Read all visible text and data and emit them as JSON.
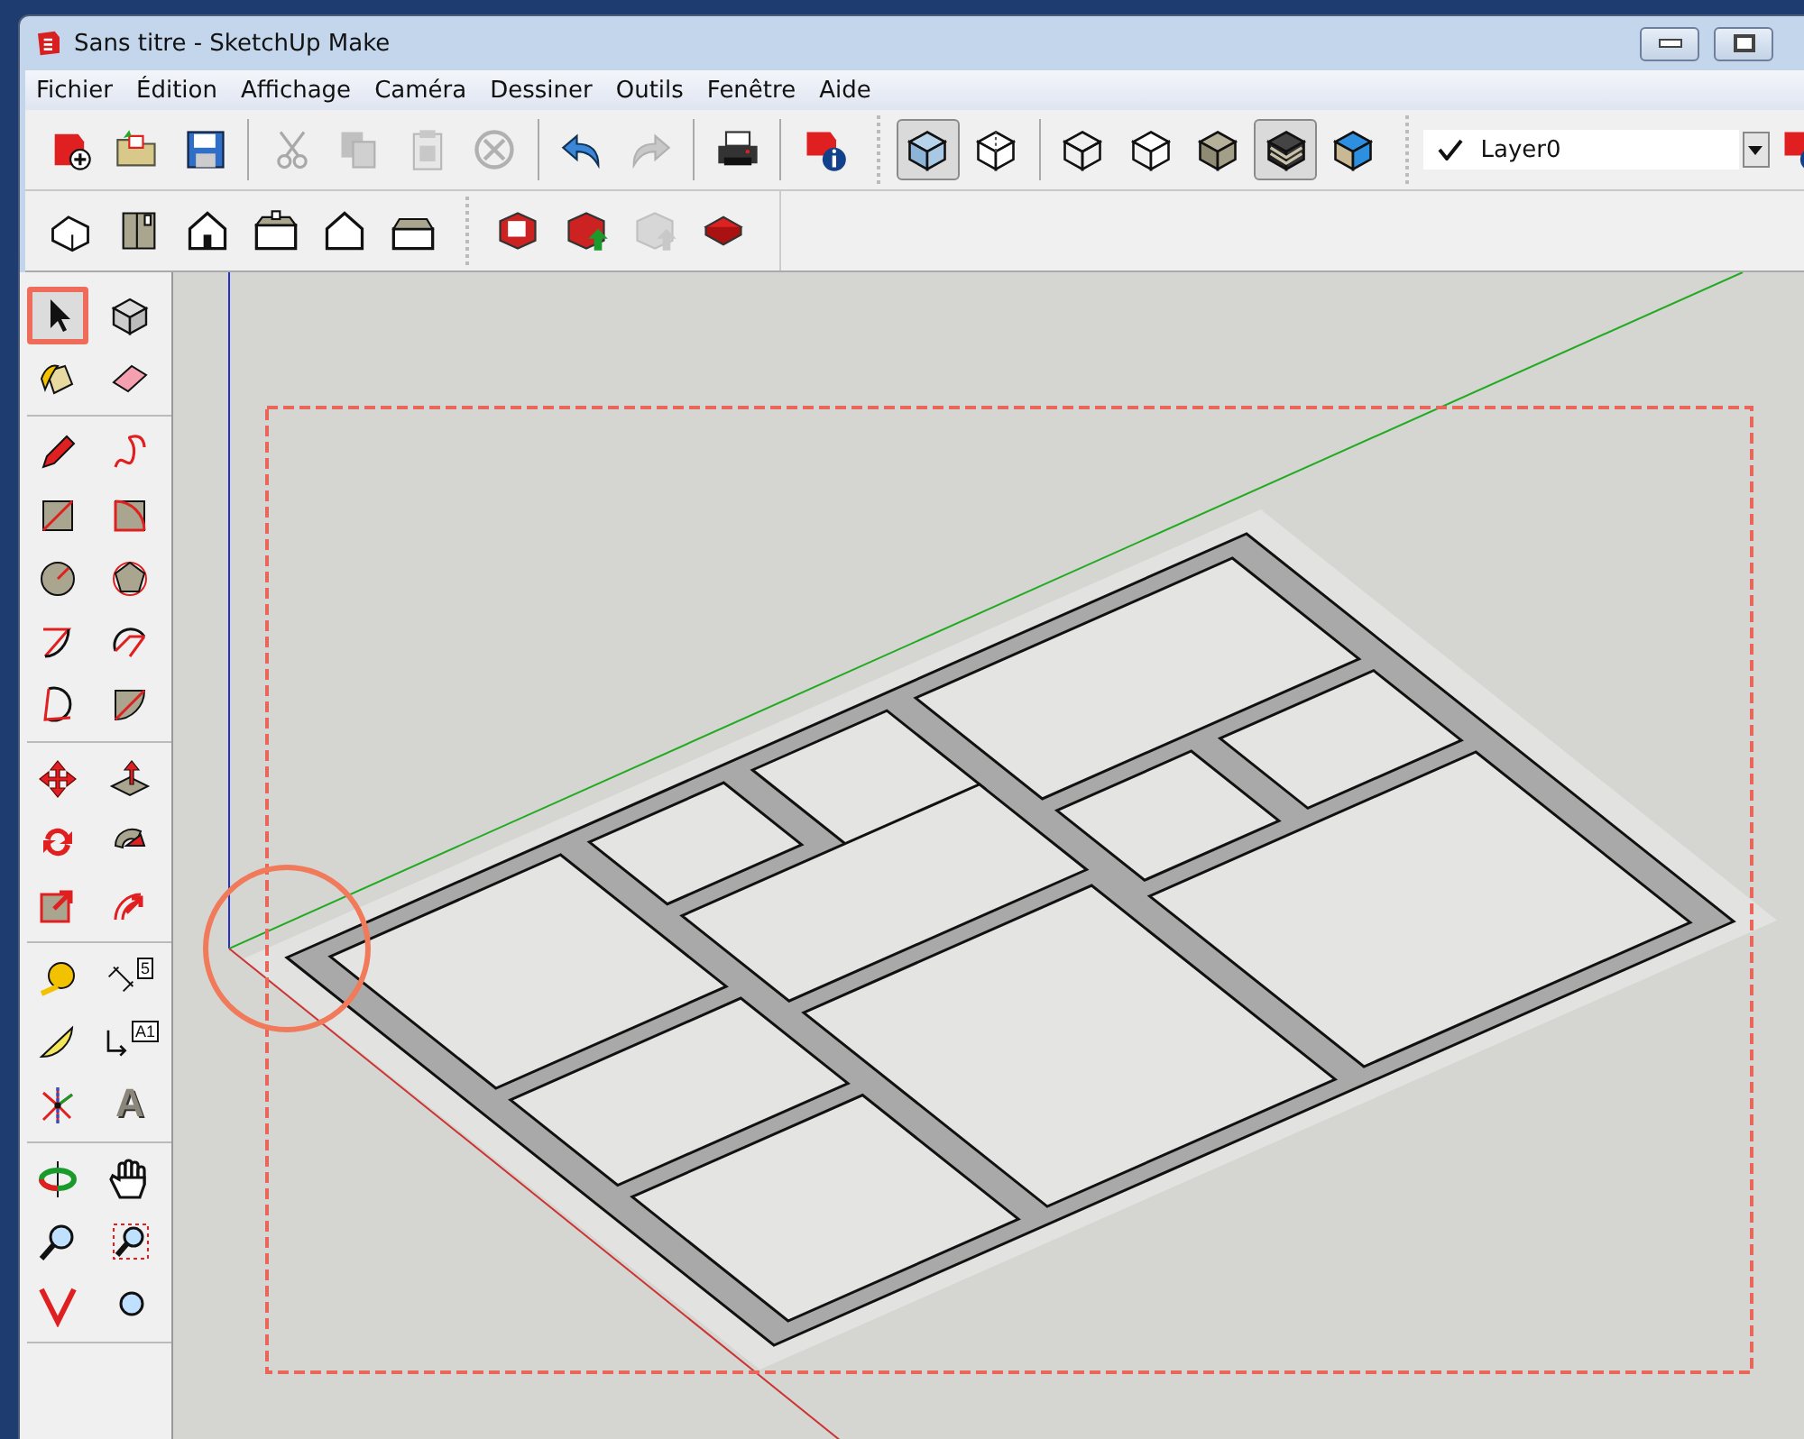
{
  "window": {
    "title": "Sans titre - SketchUp Make"
  },
  "menu": [
    "Fichier",
    "Édition",
    "Affichage",
    "Caméra",
    "Dessiner",
    "Outils",
    "Fenêtre",
    "Aide"
  ],
  "toolbar_1": [
    {
      "kind": "button",
      "disabled": false,
      "selected": false
    },
    {
      "kind": "button",
      "disabled": false,
      "selected": false
    },
    {
      "kind": "button",
      "disabled": false,
      "selected": false
    },
    {
      "kind": "separator"
    },
    {
      "kind": "button",
      "disabled": true,
      "selected": false
    },
    {
      "kind": "button",
      "disabled": true,
      "selected": false
    },
    {
      "kind": "button",
      "disabled": true,
      "selected": false
    },
    {
      "kind": "button",
      "disabled": true,
      "selected": false
    },
    {
      "kind": "separator"
    },
    {
      "kind": "button",
      "disabled": false,
      "selected": false
    },
    {
      "kind": "button",
      "disabled": true,
      "selected": false
    },
    {
      "kind": "separator"
    },
    {
      "kind": "button",
      "disabled": false,
      "selected": false
    },
    {
      "kind": "separator"
    },
    {
      "kind": "button",
      "disabled": false,
      "selected": false
    },
    {
      "kind": "grip"
    },
    {
      "kind": "button",
      "disabled": false,
      "selected": true
    },
    {
      "kind": "button",
      "disabled": false,
      "selected": false
    },
    {
      "kind": "separator"
    },
    {
      "kind": "button",
      "disabled": false,
      "selected": false
    },
    {
      "kind": "button",
      "disabled": false,
      "selected": false
    },
    {
      "kind": "button",
      "disabled": false,
      "selected": false
    },
    {
      "kind": "button",
      "disabled": false,
      "selected": true
    },
    {
      "kind": "button",
      "disabled": false,
      "selected": false
    }
  ],
  "layer": {
    "name": "Layer0",
    "current": true
  },
  "toolbar_2": [
    {
      "kind": "button",
      "disabled": false
    },
    {
      "kind": "button",
      "disabled": false
    },
    {
      "kind": "button",
      "disabled": false
    },
    {
      "kind": "button",
      "disabled": false
    },
    {
      "kind": "button",
      "disabled": false
    },
    {
      "kind": "button",
      "disabled": false
    },
    {
      "kind": "grip"
    },
    {
      "kind": "button",
      "disabled": false
    },
    {
      "kind": "button",
      "disabled": false
    },
    {
      "kind": "button",
      "disabled": true
    },
    {
      "kind": "button",
      "disabled": false
    }
  ],
  "toolbox": [
    [
      {
        "selected": true
      },
      {
        "selected": false
      },
      {
        "selected": false
      },
      {
        "selected": false
      }
    ],
    [
      {
        "selected": false
      },
      {
        "selected": false
      },
      {
        "selected": false
      },
      {
        "selected": false
      },
      {
        "selected": false
      },
      {
        "selected": false
      },
      {
        "selected": false
      },
      {
        "selected": false
      },
      {
        "selected": false
      },
      {
        "selected": false
      }
    ],
    [
      {
        "selected": false
      },
      {
        "selected": false
      },
      {
        "selected": false
      },
      {
        "selected": false
      },
      {
        "selected": false
      },
      {
        "selected": false
      }
    ],
    [
      {
        "selected": false
      },
      {
        "selected": false,
        "label": "5"
      },
      {
        "selected": false
      },
      {
        "selected": false,
        "label": "A1"
      },
      {
        "selected": false
      },
      {
        "selected": false,
        "label": "A"
      }
    ],
    [
      {
        "selected": false
      },
      {
        "selected": false
      },
      {
        "selected": false
      },
      {
        "selected": false
      },
      {
        "selected": false
      },
      {
        "selected": false
      }
    ]
  ]
}
